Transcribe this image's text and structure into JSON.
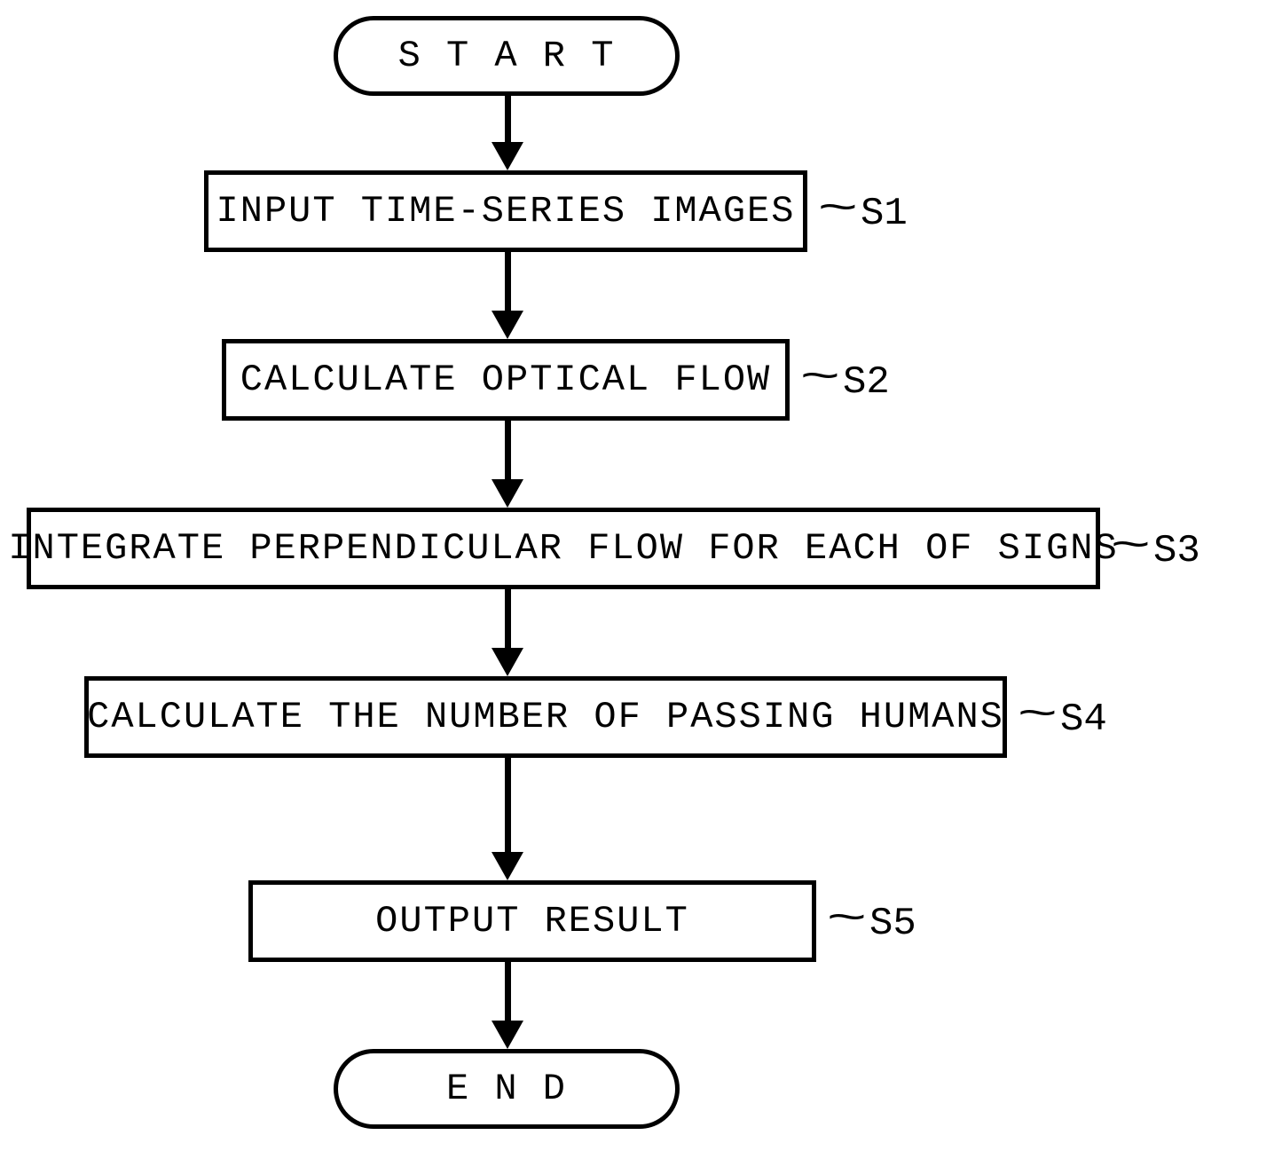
{
  "flow": {
    "start": "S T A R T",
    "end": "E N D",
    "steps": {
      "s1": {
        "text": "INPUT TIME-SERIES IMAGES",
        "label": "S1"
      },
      "s2": {
        "text": "CALCULATE OPTICAL FLOW",
        "label": "S2"
      },
      "s3": {
        "text": "INTEGRATE PERPENDICULAR FLOW FOR EACH OF SIGNS",
        "label": "S3"
      },
      "s4": {
        "text": "CALCULATE THE NUMBER OF PASSING HUMANS",
        "label": "S4"
      },
      "s5": {
        "text": "OUTPUT RESULT",
        "label": "S5"
      }
    }
  },
  "style": {
    "fontSizeNode": "42px",
    "letterSpacingNode": "2px",
    "fontSizeLabel": "44px",
    "tilde": "~"
  }
}
